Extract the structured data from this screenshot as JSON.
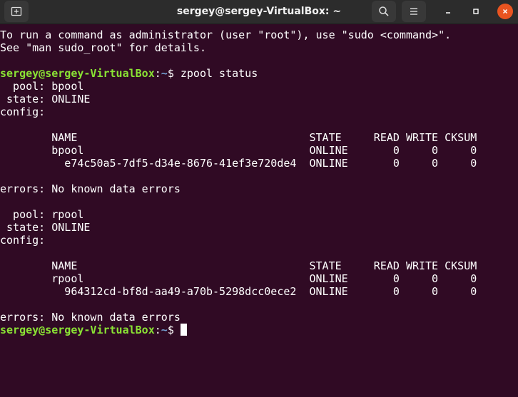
{
  "window": {
    "title": "sergey@sergey-VirtualBox: ~",
    "buttons": {
      "new_tab_icon": "new-tab-icon",
      "search_icon": "search-icon",
      "menu_icon": "hamburger-menu-icon",
      "minimize_icon": "minimize-icon",
      "maximize_icon": "maximize-icon",
      "close_icon": "close-icon"
    },
    "colors": {
      "background": "#300a24",
      "prompt_user": "#8ae234",
      "prompt_path": "#729fcf",
      "close": "#e95420"
    }
  },
  "terminal": {
    "intro": [
      "To run a command as administrator (user \"root\"), use \"sudo <command>\".",
      "See \"man sudo_root\" for details."
    ],
    "prompt": {
      "user": "sergey@sergey-VirtualBox",
      "sep": ":",
      "path": "~",
      "symbol": "$"
    },
    "command": " zpool status",
    "pools": [
      {
        "pool_line": "  pool: bpool",
        "state_line": " state: ONLINE",
        "config_line": "config:",
        "header": "        NAME                                    STATE     READ WRITE CKSUM",
        "rows": [
          "        bpool                                   ONLINE       0     0     0",
          "          e74c50a5-7df5-d34e-8676-41ef3e720de4  ONLINE       0     0     0"
        ],
        "errors_line": "errors: No known data errors"
      },
      {
        "pool_line": "  pool: rpool",
        "state_line": " state: ONLINE",
        "config_line": "config:",
        "header": "        NAME                                    STATE     READ WRITE CKSUM",
        "rows": [
          "        rpool                                   ONLINE       0     0     0",
          "          964312cd-bf8d-aa49-a70b-5298dcc0ece2  ONLINE       0     0     0"
        ],
        "errors_line": "errors: No known data errors"
      }
    ]
  }
}
